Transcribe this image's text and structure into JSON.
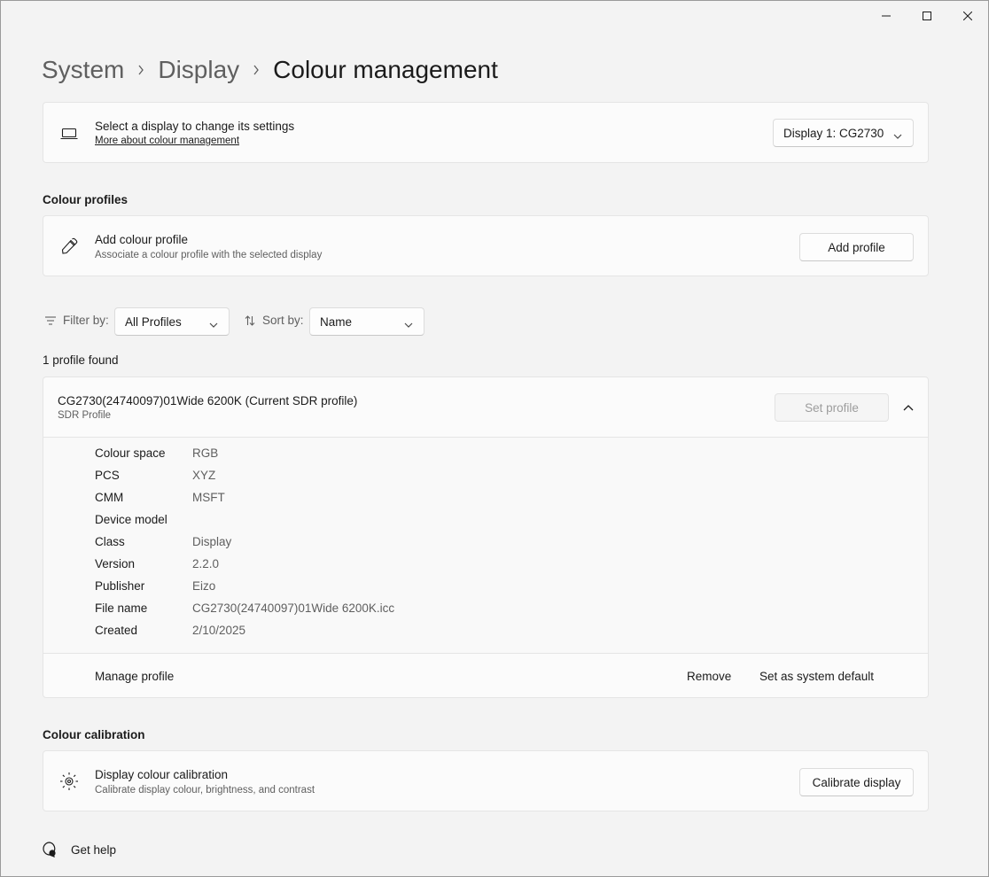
{
  "breadcrumb": {
    "system": "System",
    "display": "Display",
    "current": "Colour management"
  },
  "display_select": {
    "title": "Select a display to change its settings",
    "link": "More about colour management",
    "selected": "Display 1: CG2730"
  },
  "colour_profiles": {
    "section_title": "Colour profiles",
    "add_title": "Add colour profile",
    "add_sub": "Associate a colour profile with the selected display",
    "add_button": "Add profile"
  },
  "filters": {
    "filter_label": "Filter by:",
    "filter_value": "All Profiles",
    "sort_label": "Sort by:",
    "sort_value": "Name"
  },
  "profile_count": "1 profile found",
  "profile": {
    "name": "CG2730(24740097)01Wide 6200K (Current SDR profile)",
    "type": "SDR Profile",
    "set_button": "Set profile",
    "properties": [
      {
        "key": "Colour space",
        "value": "RGB"
      },
      {
        "key": "PCS",
        "value": "XYZ"
      },
      {
        "key": "CMM",
        "value": "MSFT"
      },
      {
        "key": "Device model",
        "value": ""
      },
      {
        "key": "Class",
        "value": "Display"
      },
      {
        "key": "Version",
        "value": "2.2.0"
      },
      {
        "key": "Publisher",
        "value": "Eizo"
      },
      {
        "key": "File name",
        "value": "CG2730(24740097)01Wide 6200K.icc"
      },
      {
        "key": "Created",
        "value": "2/10/2025"
      }
    ],
    "manage_label": "Manage profile",
    "remove_label": "Remove",
    "default_label": "Set as system default"
  },
  "calibration": {
    "section_title": "Colour calibration",
    "title": "Display colour calibration",
    "sub": "Calibrate display colour, brightness, and contrast",
    "button": "Calibrate display"
  },
  "help": {
    "label": "Get help"
  }
}
